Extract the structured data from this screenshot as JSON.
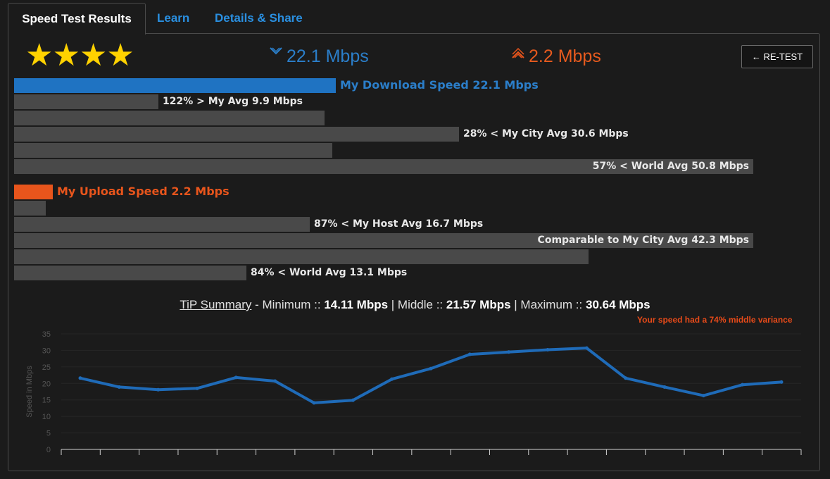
{
  "tabs": [
    {
      "label": "Speed Test Results",
      "active": true
    },
    {
      "label": "Learn",
      "active": false
    },
    {
      "label": "Details & Share",
      "active": false
    }
  ],
  "rating": {
    "stars": "★★★★",
    "value": 4
  },
  "header": {
    "download": "22.1 Mbps",
    "upload": "2.2 Mbps",
    "retest_label": "← RE-TEST"
  },
  "download_bars": [
    {
      "label": "My Download Speed 22.1 Mbps",
      "fraction": 0.435
    },
    {
      "label": "122% > My Avg 9.9 Mbps",
      "fraction": 0.195
    },
    {
      "label": "",
      "fraction": 0.42
    },
    {
      "label": "28% < My City Avg 30.6 Mbps",
      "fraction": 0.602
    },
    {
      "label": "",
      "fraction": 0.43
    },
    {
      "label": "57% < World Avg 50.8 Mbps",
      "fraction": 1.0
    }
  ],
  "upload_bars": [
    {
      "label": "My Upload Speed 2.2 Mbps",
      "fraction": 0.052
    },
    {
      "label": "",
      "fraction": 0.043
    },
    {
      "label": "87% < My Host Avg 16.7 Mbps",
      "fraction": 0.4
    },
    {
      "label": "Comparable to My City Avg 42.3 Mbps",
      "fraction": 1.0
    },
    {
      "label": "",
      "fraction": 0.777
    },
    {
      "label": "84% < World Avg 13.1 Mbps",
      "fraction": 0.314
    }
  ],
  "summary": {
    "link": "TiP Summary",
    "min_label": " - Minimum :: ",
    "min": "14.11 Mbps",
    "mid_label": " | Middle :: ",
    "mid": "21.57 Mbps",
    "max_label": " | Maximum :: ",
    "max": "30.64 Mbps",
    "variance": "Your speed had a 74% middle variance"
  },
  "colors": {
    "download": "#2b7ec9",
    "upload": "#e8551c",
    "line": "#1f6bb8",
    "stars": "#ffd200"
  },
  "chart_data": {
    "type": "line",
    "ylabel": "Speed in Mbps",
    "ylim": [
      0,
      35
    ],
    "yticks": [
      0,
      5,
      10,
      15,
      20,
      25,
      30,
      35
    ],
    "x": [
      1,
      2,
      3,
      4,
      5,
      6,
      7,
      8,
      9,
      10,
      11,
      12,
      13,
      14,
      15,
      16,
      17,
      18,
      19
    ],
    "series": [
      {
        "values": [
          21.6,
          18.9,
          18.1,
          18.5,
          21.8,
          20.7,
          14.1,
          14.9,
          21.3,
          24.5,
          28.8,
          29.5,
          30.2,
          30.7,
          21.6,
          18.9,
          16.3,
          19.6,
          20.4
        ]
      }
    ],
    "grid": true
  }
}
